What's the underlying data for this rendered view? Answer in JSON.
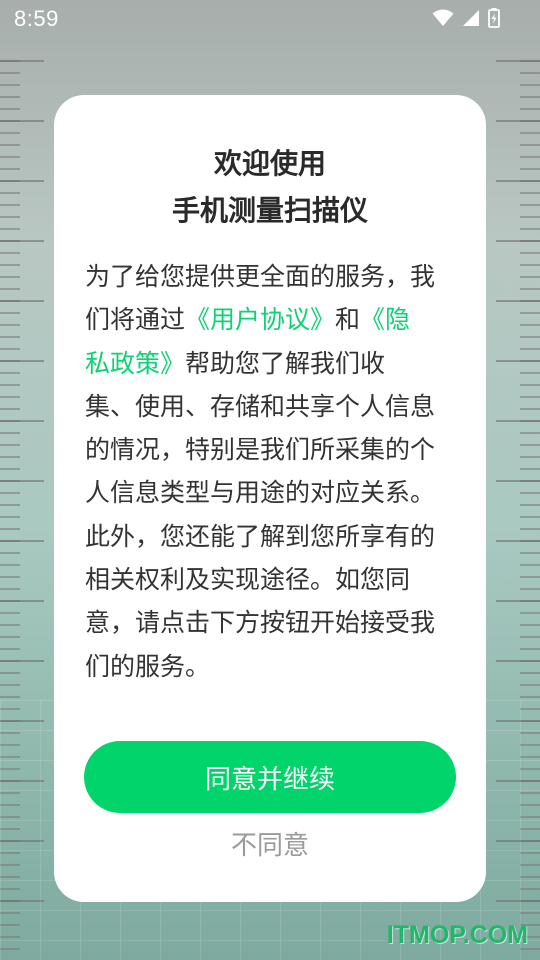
{
  "status_bar": {
    "time": "8:59",
    "icons": [
      "wifi-icon",
      "cell-signal-icon",
      "battery-charging-icon"
    ]
  },
  "dialog": {
    "title_line1": "欢迎使用",
    "title_line2": "手机测量扫描仪",
    "body": {
      "part1": "为了给您提供更全面的服务，我们将通过",
      "user_agreement_link": "《用户协议》",
      "part2": "和",
      "privacy_policy_link": "《隐私政策》",
      "part3": "帮助您了解我们收集、使用、存储和共享个人信息的情况，特别是我们所采集的个人信息类型与用途的对应关系。此外，您还能了解到您所享有的相关权利及实现途径。如您同意，请点击下方按钮开始接受我们的服务。"
    },
    "agree_button_label": "同意并继续",
    "disagree_button_label": "不同意"
  },
  "watermark": "ITMOP.COM",
  "colors": {
    "accent": "#00d46a",
    "link": "#0ed274",
    "watermark": "#1fb86a"
  }
}
